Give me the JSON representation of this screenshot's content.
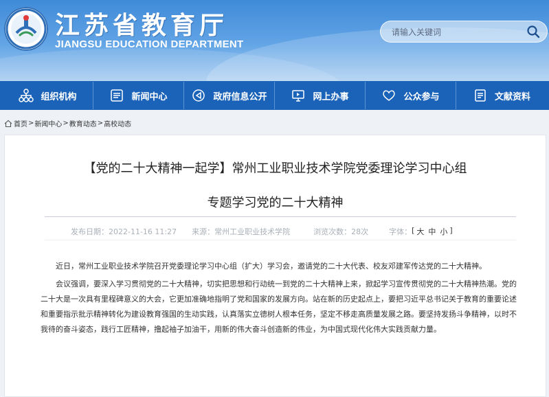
{
  "header": {
    "title_cn": "江苏省教育厅",
    "title_en": "JIANGSU EDUCATION DEPARTMENT",
    "search_placeholder": "请输入关键词"
  },
  "nav": {
    "items": [
      {
        "label": "组织机构",
        "icon": "org-chart-icon"
      },
      {
        "label": "新闻中心",
        "icon": "news-icon"
      },
      {
        "label": "政府信息公开",
        "icon": "info-disclosure-icon"
      },
      {
        "label": "网上办事",
        "icon": "online-service-icon"
      },
      {
        "label": "公众参与",
        "icon": "heart-icon"
      },
      {
        "label": "文献资料",
        "icon": "document-icon"
      }
    ]
  },
  "breadcrumb": {
    "items": [
      "首页",
      "新闻中心",
      "教育动态",
      "高校动态"
    ],
    "separator": ">"
  },
  "article": {
    "title_line1": "【党的二十大精神一起学】常州工业职业技术学院党委理论学习中心组",
    "title_line2": "专题学习党的二十大精神",
    "meta": {
      "date": "发布日期：2022-11-16 11:27",
      "source": "来源：常州工业职业技术学院",
      "views": "浏览次数：28次",
      "font_label": "字体：",
      "font_open": "[",
      "font_large": "大",
      "font_medium": "中",
      "font_small": "小",
      "font_close": "]"
    },
    "paragraphs": [
      "近日，常州工业职业技术学院召开党委理论学习中心组（扩大）学习会，邀请党的二十大代表、校友邓建军传达党的二十大精神。",
      "会议强调，要深入学习贯彻党的二十大精神，切实把思想和行动统一到党的二十大精神上来，掀起学习宣传贯彻党的二十大精神热潮。党的二十大是一次具有里程碑意义的大会，它更加准确地指明了党和国家的发展方向。站在新的历史起点上，要把习近平总书记关于教育的重要论述和重要指示批示精神转化为建设教育强国的生动实践，认真落实立德树人根本任务，坚定不移走高质量发展之路。要坚持发扬斗争精神，以时不我待的奋斗姿态，践行工匠精神，撸起袖子加油干，用新的伟大奋斗创造新的伟业，为中国式现代化伟大实践贡献力量。"
    ]
  },
  "colors": {
    "nav_bg": "#1a63b8",
    "banner_top": "#3f8ad8",
    "text": "#333333"
  }
}
